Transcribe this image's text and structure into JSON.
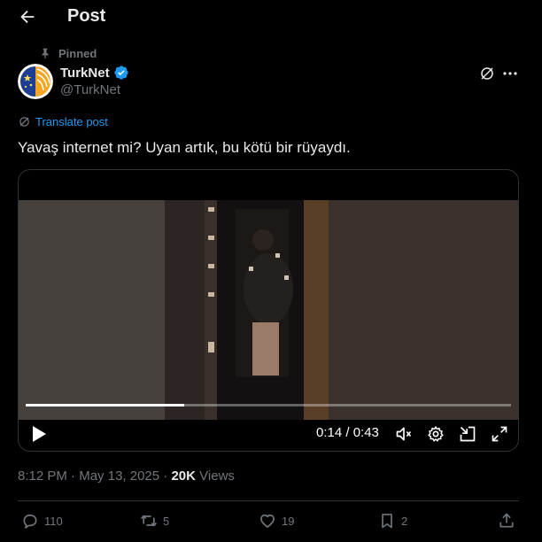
{
  "header": {
    "title": "Post"
  },
  "pinned_label": "Pinned",
  "author": {
    "name": "TurkNet",
    "handle": "@TurkNet"
  },
  "translate_label": "Translate post",
  "post_text": "Yavaş internet mi? Uyan artık, bu kötü bir rüyaydı.",
  "video": {
    "time_current": "0:14",
    "time_total": "0:43",
    "time_display": "0:14 / 0:43",
    "progress": 0.326
  },
  "meta": {
    "time": "8:12 PM",
    "date": "May 13, 2025",
    "separator": "·",
    "views_count": "20K",
    "views_label": "Views"
  },
  "actions": {
    "replies": "110",
    "reposts": "5",
    "likes": "19",
    "bookmarks": "2"
  },
  "colors": {
    "background": "#000000",
    "text": "#e7e9ea",
    "muted": "#71767b",
    "accent": "#1d9bf0",
    "border": "#2f3336"
  },
  "icons": [
    "back-arrow-icon",
    "pin-icon",
    "verified-badge-icon",
    "grok-icon",
    "more-icon",
    "translate-icon",
    "play-icon",
    "mute-icon",
    "settings-icon",
    "minimize-icon",
    "fullscreen-icon",
    "reply-icon",
    "repost-icon",
    "like-icon",
    "bookmark-icon",
    "share-icon"
  ]
}
